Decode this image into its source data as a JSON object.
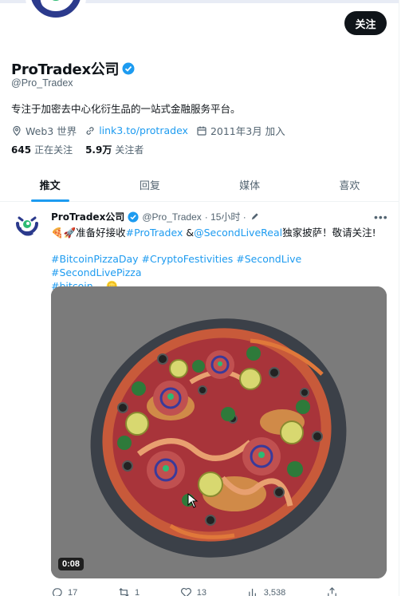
{
  "profile": {
    "name": "ProTradex公司",
    "handle": "@Pro_Tradex",
    "verified": true,
    "bio": "专注于加密去中心化衍生品的一站式金融服务平台。",
    "location": "Web3 世界",
    "website": "link3.to/protradex",
    "joined": "2011年3月 加入",
    "following_count": "645",
    "following_label": "正在关注",
    "followers_count": "5.9万",
    "followers_label": "关注者",
    "follow_button": "关注"
  },
  "tabs": [
    {
      "label": "推文",
      "active": true
    },
    {
      "label": "回复",
      "active": false
    },
    {
      "label": "媒体",
      "active": false
    },
    {
      "label": "喜欢",
      "active": false
    }
  ],
  "tweet": {
    "name": "ProTradex公司",
    "handle": "@Pro_Tradex",
    "time": "· 15小时 ·",
    "emojis": "🍕🚀",
    "text_prefix": "准备好接收",
    "mention1": "#ProTradex",
    "text_mid": " &",
    "mention2": "@SecondLiveReal",
    "text_suffix": "独家披萨！敬请关注!",
    "tags_line1": "#BitcoinPizzaDay #CryptoFestivities #SecondLive #SecondLivePizza",
    "tags_line2": "#bitcoin",
    "coin_emoji": "🪙",
    "video_duration": "0:08",
    "replies": "17",
    "retweets": "1",
    "likes": "13",
    "views": "3,538"
  },
  "colors": {
    "accent": "#1d9bf0",
    "button_bg": "#0f1419",
    "brand_navy": "#2b3a8c",
    "brand_green": "#2dbb73"
  },
  "icons": [
    "verified-badge-icon",
    "location-icon",
    "link-icon",
    "calendar-icon",
    "edit-icon",
    "more-icon",
    "reply-icon",
    "retweet-icon",
    "like-icon",
    "views-icon",
    "share-icon"
  ]
}
